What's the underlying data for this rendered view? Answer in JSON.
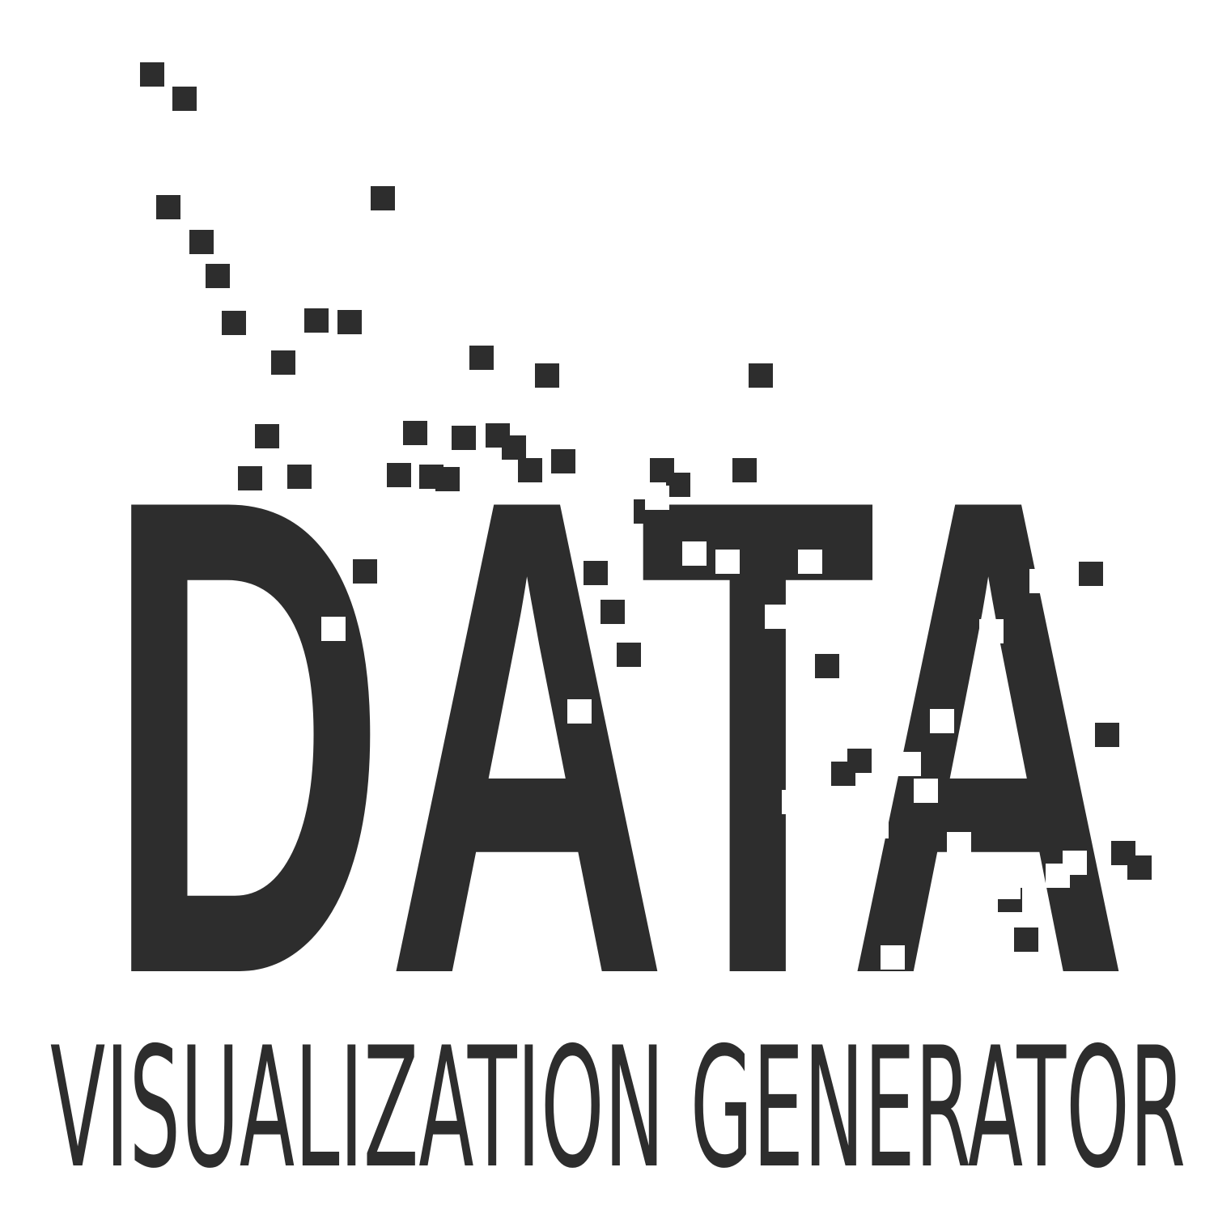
{
  "logo": {
    "title": "DATA",
    "subtitle": "VISUALIZATION GENERATOR",
    "ink_color": "#2d2d2d",
    "background_color": "#ffffff",
    "decoration": "scattered-pixel-squares"
  }
}
